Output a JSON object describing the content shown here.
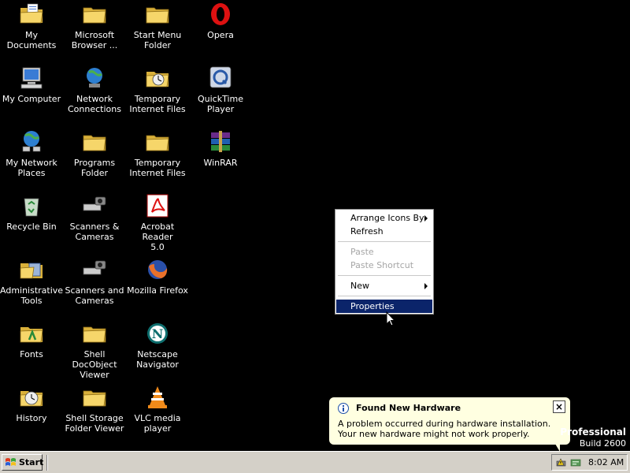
{
  "desktop": {
    "icons": [
      {
        "label": "My Documents",
        "icon": "my-documents-icon"
      },
      {
        "label": "Microsoft\nBrowser ...",
        "icon": "folder-icon"
      },
      {
        "label": "Start Menu\nFolder",
        "icon": "folder-icon"
      },
      {
        "label": "Opera",
        "icon": "opera-icon"
      },
      {
        "label": "My Computer",
        "icon": "my-computer-icon"
      },
      {
        "label": "Network\nConnections",
        "icon": "network-connections-icon"
      },
      {
        "label": "Temporary\nInternet Files",
        "icon": "temp-internet-files-icon"
      },
      {
        "label": "QuickTime\nPlayer",
        "icon": "quicktime-icon"
      },
      {
        "label": "My Network\nPlaces",
        "icon": "network-places-icon"
      },
      {
        "label": "Programs\nFolder",
        "icon": "folder-icon"
      },
      {
        "label": "Temporary\nInternet Files",
        "icon": "folder-icon"
      },
      {
        "label": "WinRAR",
        "icon": "winrar-icon"
      },
      {
        "label": "Recycle Bin",
        "icon": "recycle-bin-icon"
      },
      {
        "label": "Scanners &\nCameras",
        "icon": "scanner-icon"
      },
      {
        "label": "Acrobat Reader\n5.0",
        "icon": "acrobat-icon"
      },
      {
        "label": "Administrative\nTools",
        "icon": "admin-tools-icon"
      },
      {
        "label": "Scanners and\nCameras",
        "icon": "scanner-icon"
      },
      {
        "label": "Mozilla Firefox",
        "icon": "firefox-icon"
      },
      {
        "label": "Fonts",
        "icon": "fonts-folder-icon"
      },
      {
        "label": "Shell DocObject\nViewer",
        "icon": "folder-icon"
      },
      {
        "label": "Netscape\nNavigator",
        "icon": "netscape-icon"
      },
      {
        "label": "History",
        "icon": "history-icon"
      },
      {
        "label": "Shell Storage\nFolder Viewer",
        "icon": "folder-icon"
      },
      {
        "label": "VLC media\nplayer",
        "icon": "vlc-icon"
      }
    ]
  },
  "context_menu": {
    "arrange": "Arrange Icons By",
    "refresh": "Refresh",
    "paste": "Paste",
    "paste_shortcut": "Paste Shortcut",
    "new": "New",
    "properties": "Properties"
  },
  "balloon": {
    "title": "Found New Hardware",
    "message": "A problem occurred during hardware installation. Your new hardware might not work properly.",
    "close": "×"
  },
  "watermark": {
    "edition": "Professional",
    "build": "Build 2600"
  },
  "taskbar": {
    "start_label": "Start",
    "clock": "8:02 AM"
  },
  "colors": {
    "desktop_bg": "#000000",
    "taskbar_bg": "#d4d0c8",
    "menu_highlight": "#0b246a",
    "balloon_bg": "#ffffe1"
  }
}
